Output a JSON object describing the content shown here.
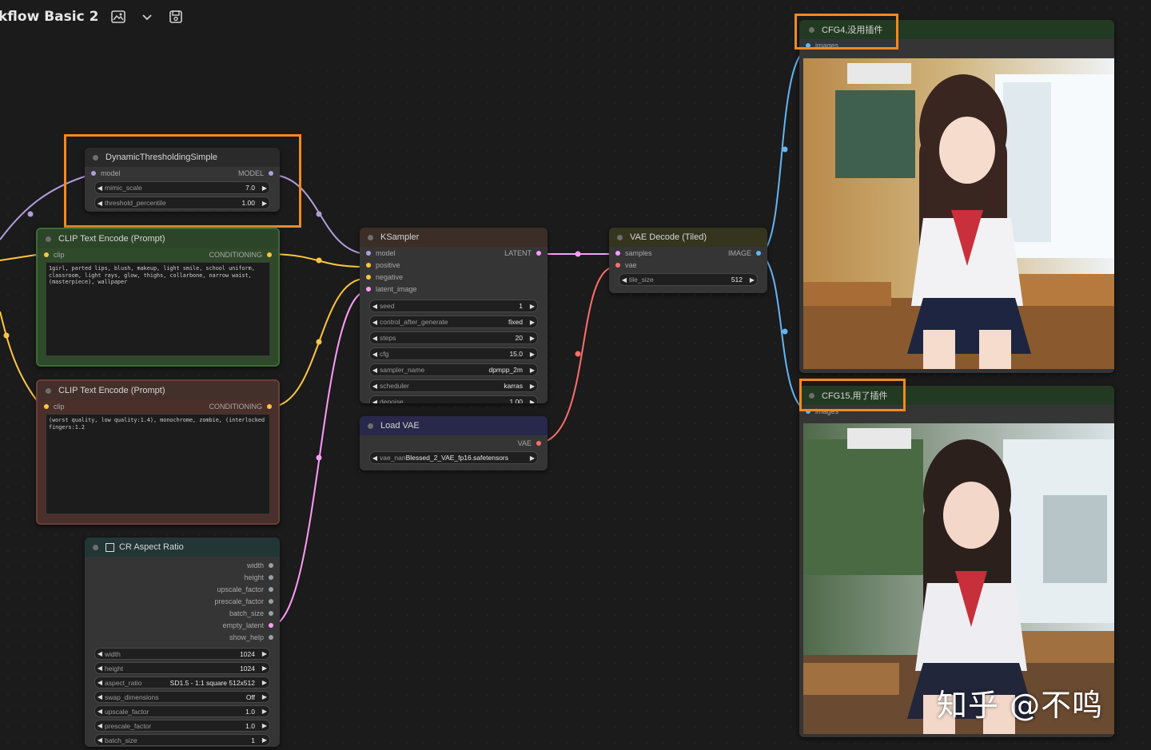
{
  "workflow": {
    "title": "kflow Basic 2"
  },
  "colors": {
    "model": "#b39ddb",
    "conditioning": "#ffc640",
    "latent": "#ff9cf9",
    "vae": "#ff6e6e",
    "image": "#64b5f6",
    "highlight": "#f08a24"
  },
  "nodes": {
    "dynthresh": {
      "title": "DynamicThresholdingSimple",
      "input": "model",
      "output": "MODEL",
      "widgets": [
        {
          "name": "mimic_scale",
          "value": "7.0"
        },
        {
          "name": "threshold_percentile",
          "value": "1.00"
        }
      ]
    },
    "clip_pos": {
      "title": "CLIP Text Encode (Prompt)",
      "input": "clip",
      "output": "CONDITIONING",
      "text": "1girl, parted lips, blush, makeup, light smile, school uniform, classroom, light rays, glow, thighs, collarbone, narrow waist, (masterpiece), wallpaper"
    },
    "clip_neg": {
      "title": "CLIP Text Encode (Prompt)",
      "input": "clip",
      "output": "CONDITIONING",
      "text": "(worst quality, low quality:1.4), monochrome, zombie, (interlocked fingers:1.2"
    },
    "ksampler": {
      "title": "KSampler",
      "inputs": [
        "model",
        "positive",
        "negative",
        "latent_image"
      ],
      "output": "LATENT",
      "widgets": [
        {
          "name": "seed",
          "value": "1"
        },
        {
          "name": "control_after_generate",
          "value": "fixed"
        },
        {
          "name": "steps",
          "value": "20"
        },
        {
          "name": "cfg",
          "value": "15.0"
        },
        {
          "name": "sampler_name",
          "value": "dpmpp_2m"
        },
        {
          "name": "scheduler",
          "value": "karras"
        },
        {
          "name": "denoise",
          "value": "1.00"
        }
      ]
    },
    "vaedecode": {
      "title": "VAE Decode (Tiled)",
      "inputs": [
        "samples",
        "vae"
      ],
      "output": "IMAGE",
      "widgets": [
        {
          "name": "tile_size",
          "value": "512"
        }
      ]
    },
    "loadvae": {
      "title": "Load VAE",
      "output": "VAE",
      "widgets": [
        {
          "name": "vae_nan",
          "value": "Blessed_2_VAE_fp16.safetensors"
        }
      ]
    },
    "aspect": {
      "title": "CR Aspect Ratio",
      "outputs": [
        "width",
        "height",
        "upscale_factor",
        "prescale_factor",
        "batch_size",
        "empty_latent",
        "show_help"
      ],
      "widgets": [
        {
          "name": "width",
          "value": "1024"
        },
        {
          "name": "height",
          "value": "1024"
        },
        {
          "name": "aspect_ratio",
          "value": "SD1.5 - 1:1 square 512x512"
        },
        {
          "name": "swap_dimensions",
          "value": "Off"
        },
        {
          "name": "upscale_factor",
          "value": "1.0"
        },
        {
          "name": "prescale_factor",
          "value": "1.0"
        },
        {
          "name": "batch_size",
          "value": "1"
        }
      ]
    },
    "preview1": {
      "title": "CFG4,没用插件",
      "input": "images"
    },
    "preview2": {
      "title": "CFG15,用了插件",
      "input": "images"
    }
  },
  "watermark": "知乎 @不鸣"
}
